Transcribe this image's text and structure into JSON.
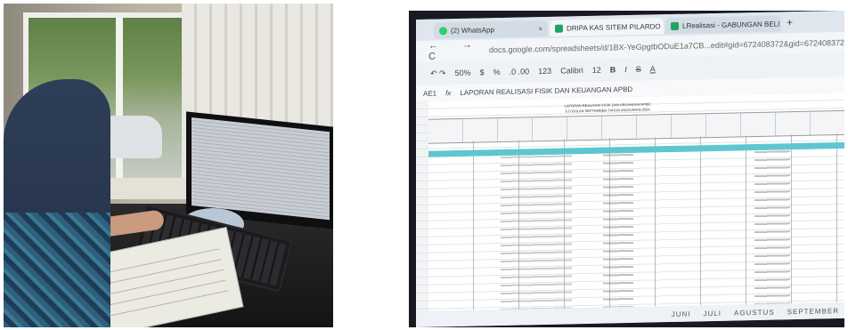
{
  "photo_left": {
    "subject": ""
  },
  "photo_right": {
    "tabs": [
      {
        "label": "(2) WhatsApp",
        "close": "×"
      },
      {
        "label": "DRIPA KAS SITEM PILARDO",
        "close": "×"
      },
      {
        "label": "LRealisasi - GABUNGAN BELI",
        "close": "×"
      }
    ],
    "new_tab": "+",
    "nav_glyphs": "← → C",
    "url": "docs.google.com/spreadsheets/d/1BX-YeGpgtbODuE1a7CB...edit#gid=672408372&gid=672408372",
    "toolbar": {
      "undo_redo": "↶ ↷",
      "zoom": "50%",
      "currency": "$",
      "percent": "%",
      "decimals": ".0 .00",
      "format": "123",
      "font": "Calibri",
      "font_size": "12",
      "bold": "B",
      "italic": "I",
      "strike": "S",
      "text_color": "A"
    },
    "formula_bar": {
      "cell": "AE1",
      "fx": "fx",
      "content": "LAPORAN REALISASI FISIK DAN KEUANGAN APBD"
    },
    "sheet_title_lines": [
      "LAPORAN REALISASI FISIK DAN KEUANGAN APBD",
      "S.D BULAN SEPTEMBER TAHUN ANGGARAN 2024"
    ],
    "sheet_tabs": [
      "JUNI",
      "JULI",
      "AGUSTUS",
      "SEPTEMBER"
    ]
  }
}
